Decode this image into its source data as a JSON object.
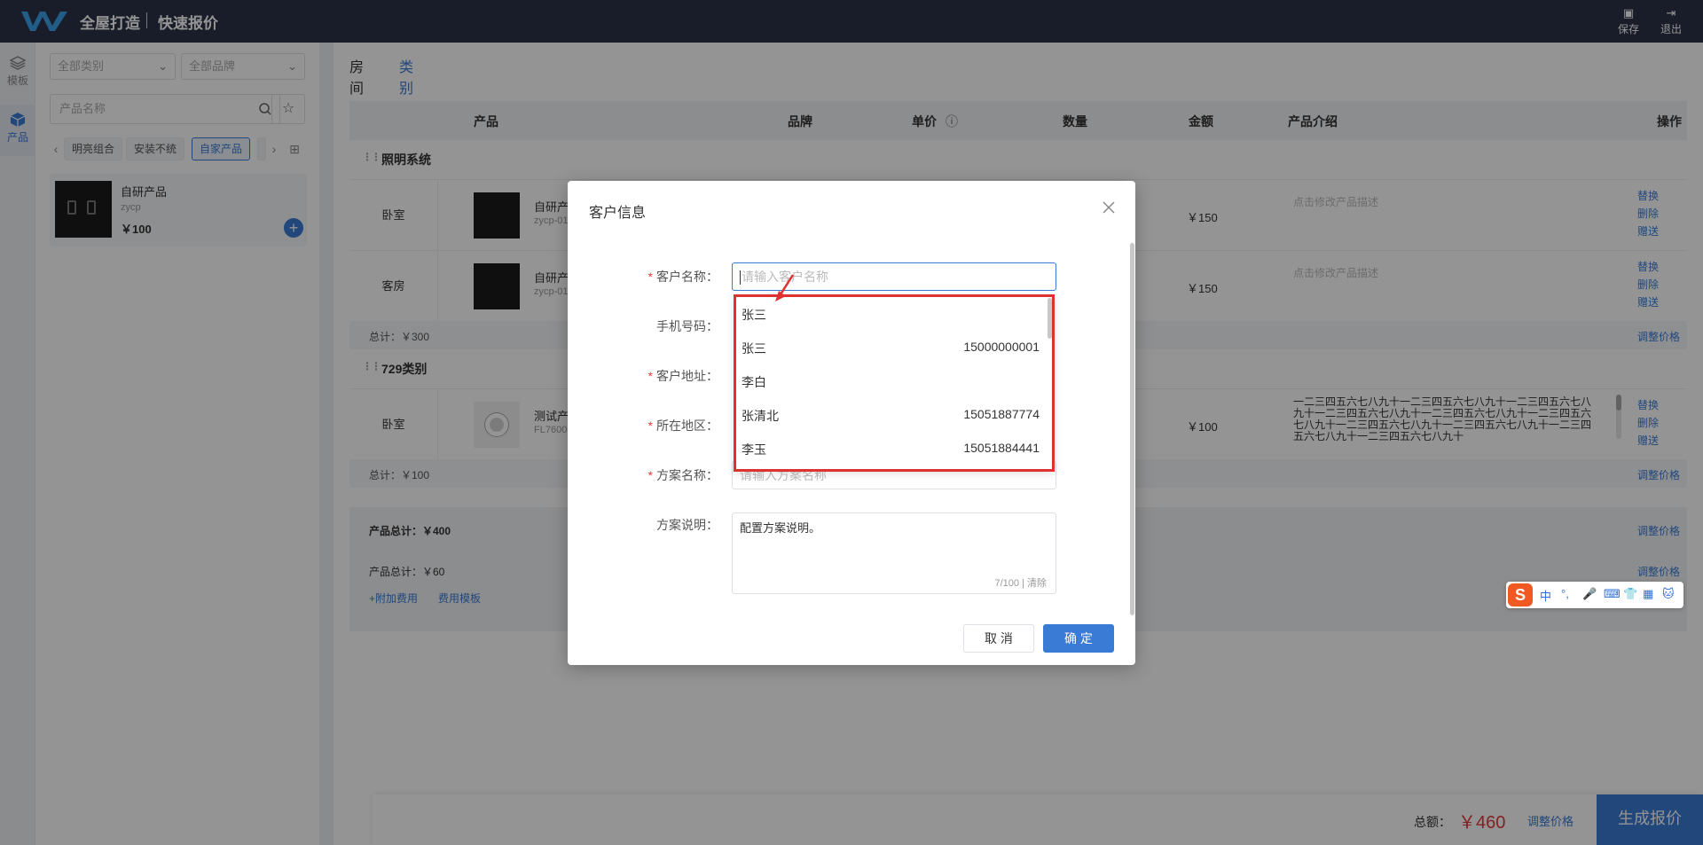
{
  "header": {
    "app_title": "全屋打造",
    "sub_title": "快速报价",
    "save_label": "保存",
    "exit_label": "退出"
  },
  "leftnav": {
    "items": [
      {
        "label": "模板",
        "icon": "layers-icon"
      },
      {
        "label": "产品",
        "icon": "cube-icon"
      }
    ]
  },
  "sidebar": {
    "category_select": "全部类别",
    "brand_select": "全部品牌",
    "search_placeholder": "产品名称",
    "chips": [
      "明亮组合",
      "安装不统",
      "自家产品"
    ],
    "product": {
      "name": "自研产品",
      "code": "zycp",
      "price": "￥100"
    }
  },
  "main": {
    "tabs": [
      "房间",
      "类别"
    ],
    "columns": [
      "产品",
      "品牌",
      "单价",
      "数量",
      "金额",
      "产品介绍",
      "操作"
    ],
    "sections": [
      {
        "title": "照明系统",
        "rows": [
          {
            "room": "卧室",
            "name": "自研产",
            "code": "zycp-01",
            "amount": "￥150",
            "desc": "点击修改产品描述"
          },
          {
            "room": "客房",
            "name": "自研产",
            "code": "zycp-01",
            "amount": "￥150",
            "desc": "点击修改产品描述"
          }
        ],
        "total": "总计：￥300"
      },
      {
        "title": "729类别",
        "rows": [
          {
            "room": "卧室",
            "name": "测试产",
            "code": "FL7600",
            "amount": "￥100",
            "desc": "一二三四五六七八九十一二三四五六七八九十一二三四五六七八九十一二三四五六七八九十一二三四五六七八九十一二三四五六七八九十一二三四五六七八九十一二三四五六七八九十一二三四五六七八九十一二三四五六七八九十"
          }
        ],
        "total": "总计：￥100"
      }
    ],
    "ops": [
      "替换",
      "删除",
      "赠送"
    ],
    "adjust_price": "调整价格",
    "summary": {
      "product_total": "产品总计：￥400",
      "product_total2": "产品总计：￥60",
      "add_fee": "+附加费用",
      "fee_template": "费用模板"
    }
  },
  "bottombar": {
    "total_label": "总额：",
    "total_value": "￥460",
    "adjust": "调整价格",
    "generate": "生成报价"
  },
  "modal": {
    "title": "客户信息",
    "fields": {
      "customer_name": {
        "label": "客户名称：",
        "placeholder": "请输入客户名称",
        "required": true
      },
      "phone": {
        "label": "手机号码：",
        "required": false
      },
      "address": {
        "label": "客户地址：",
        "required": true
      },
      "region": {
        "label": "所在地区：",
        "required": true
      },
      "plan_name": {
        "label": "方案名称：",
        "placeholder": "请输入方案名称",
        "required": true
      },
      "plan_desc": {
        "label": "方案说明：",
        "value": "配置方案说明。",
        "count": "7/100",
        "clear": "清除"
      }
    },
    "cancel": "取 消",
    "ok": "确 定"
  },
  "dropdown": {
    "items": [
      {
        "name": "张三",
        "phone": ""
      },
      {
        "name": "张三",
        "phone": "15000000001"
      },
      {
        "name": "李白",
        "phone": ""
      },
      {
        "name": "张清北",
        "phone": "15051887774"
      },
      {
        "name": "李玉",
        "phone": "15051884441"
      }
    ]
  },
  "ime": {
    "items": [
      "中",
      "°,",
      "🎤",
      "⌨",
      "👕",
      "▦",
      "🐱"
    ]
  },
  "colors": {
    "accent": "#3a7bd5",
    "header": "#2a3347",
    "danger": "#e03131",
    "price": "#e23b3b"
  }
}
